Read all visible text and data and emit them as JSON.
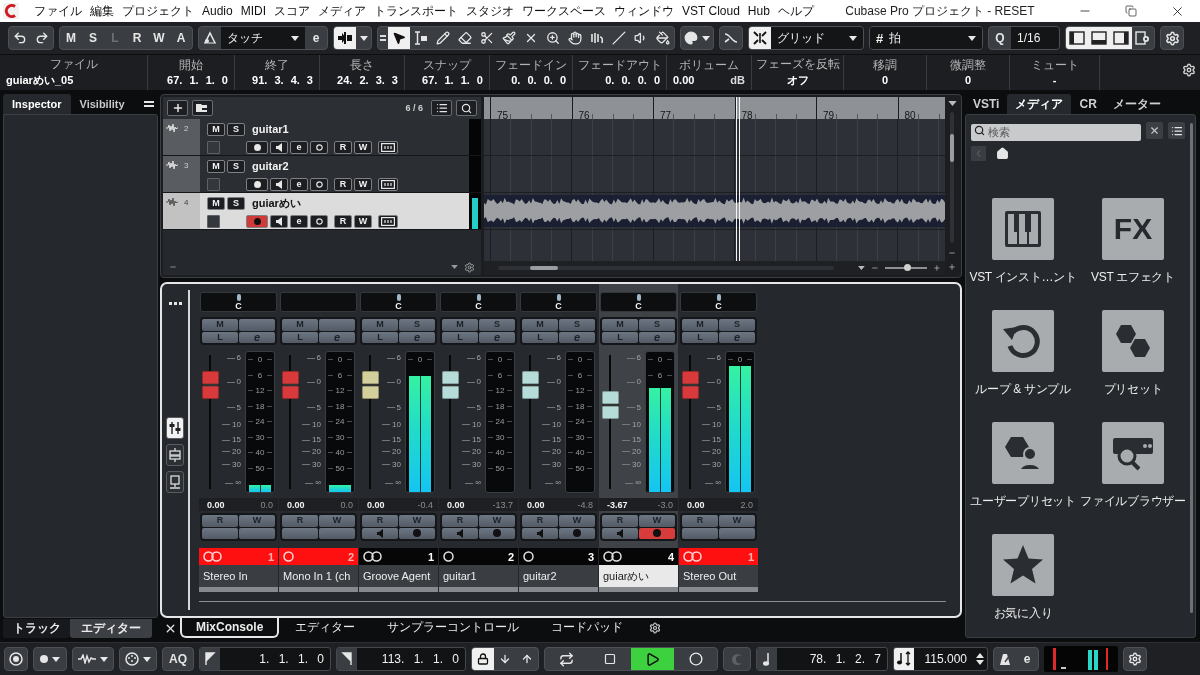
{
  "title_bar": {
    "menu": [
      "ファイル",
      "編集",
      "プロジェクト",
      "Audio",
      "MIDI",
      "スコア",
      "メディア",
      "トランスポート",
      "スタジオ",
      "ワークスペース",
      "ウィンドウ",
      "VST Cloud",
      "Hub",
      "ヘルプ"
    ],
    "title": "Cubase Pro プロジェクト - RESET"
  },
  "toolbar": {
    "state_buttons": [
      {
        "label": "M",
        "disabled": false
      },
      {
        "label": "S",
        "disabled": false
      },
      {
        "label": "L",
        "disabled": true
      },
      {
        "label": "R",
        "disabled": false
      },
      {
        "label": "W",
        "disabled": false
      },
      {
        "label": "A",
        "disabled": false
      }
    ],
    "automation_mode": "タッチ",
    "automation_edit": "e",
    "drag_mode": {
      "on": true
    },
    "tools": [
      {
        "kind": "select",
        "selected": true
      },
      {
        "kind": "range",
        "selected": false
      },
      {
        "kind": "draw",
        "selected": false
      },
      {
        "kind": "erase",
        "selected": false
      },
      {
        "kind": "split",
        "selected": false
      },
      {
        "kind": "glue",
        "selected": false
      },
      {
        "kind": "mute",
        "selected": false
      },
      {
        "kind": "zoom",
        "selected": false
      },
      {
        "kind": "hand",
        "selected": false
      },
      {
        "kind": "comp",
        "selected": false
      },
      {
        "kind": "line",
        "selected": false
      },
      {
        "kind": "play",
        "selected": false
      },
      {
        "kind": "fill",
        "selected": false
      }
    ],
    "snap": {
      "on": true,
      "mode": "グリッド"
    },
    "grid_type": {
      "symbol": "#",
      "value": "拍"
    },
    "quantize": {
      "symbol": "Q",
      "value": "1/16"
    },
    "zone_toggles": [
      {
        "kind": "left",
        "on": true
      },
      {
        "kind": "lower",
        "on": true
      },
      {
        "kind": "right",
        "on": true
      },
      {
        "kind": "setup",
        "on": false
      }
    ]
  },
  "info_line": {
    "file_label": "ファイル",
    "file": "guiarめい_05",
    "fields": [
      {
        "kind": "position",
        "label": "開始",
        "value": "67. 1. 1. 0"
      },
      {
        "kind": "position",
        "label": "終了",
        "value": "91. 3. 4. 3"
      },
      {
        "kind": "position",
        "label": "長さ",
        "value": "24. 2. 3. 3"
      },
      {
        "kind": "position",
        "label": "スナップ",
        "value": "67. 1. 1. 0"
      },
      {
        "kind": "position",
        "label": "フェードイン",
        "value": "0. 0. 0. 0"
      },
      {
        "kind": "position",
        "label": "フェードアウト",
        "value": "0. 0. 0. 0"
      },
      {
        "kind": "volume",
        "label": "ボリューム",
        "value": "0.00",
        "unit": "dB"
      },
      {
        "kind": "text",
        "label": "フェーズを反転",
        "value": "オフ"
      },
      {
        "kind": "text",
        "label": "移調",
        "value": "0"
      },
      {
        "kind": "text",
        "label": "微調整",
        "value": "0"
      },
      {
        "kind": "text",
        "label": "ミュート",
        "value": "-"
      }
    ]
  },
  "left_zone": {
    "tabs": [
      {
        "label": "Inspector",
        "selected": true
      },
      {
        "label": "Visibility",
        "selected": false
      }
    ],
    "bottom_tabs": [
      {
        "label": "トラック",
        "selected": true
      },
      {
        "label": "エディター",
        "selected": false
      }
    ]
  },
  "project": {
    "track_count": "6 / 6",
    "tracks": [
      {
        "number": "2",
        "name": "guitar1",
        "mute": "M",
        "solo": "S",
        "edit": "e",
        "read": "R",
        "write": "W",
        "selected": false,
        "record_enabled": false,
        "has_audio_event": false,
        "meter": {
          "level": 0
        }
      },
      {
        "number": "3",
        "name": "guitar2",
        "mute": "M",
        "solo": "S",
        "edit": "e",
        "read": "R",
        "write": "W",
        "selected": false,
        "record_enabled": false,
        "has_audio_event": false,
        "meter": {
          "level": 0
        }
      },
      {
        "number": "4",
        "name": "guiarめい",
        "mute": "M",
        "solo": "S",
        "edit": "e",
        "read": "R",
        "write": "W",
        "selected": true,
        "record_enabled": true,
        "has_audio_event": true,
        "meter": {
          "level": 0.85
        }
      }
    ],
    "ruler": [
      "75",
      "76",
      "77",
      "78",
      "79",
      "80"
    ],
    "zoom": {
      "level": 0.55
    }
  },
  "lower_zone": {
    "view_buttons": [
      {
        "kind": "faders",
        "selected": true
      },
      {
        "kind": "racks",
        "selected": false
      },
      {
        "kind": "monitor",
        "selected": false
      }
    ],
    "channels": [
      {
        "kind": "input",
        "stereo": true,
        "pan": "C",
        "mute": "M",
        "listen": "L",
        "edit": "e",
        "read": "R",
        "write": "W",
        "fader_scale": [
          "6",
          "0",
          "5",
          "10",
          "15",
          "20",
          "30",
          "∞"
        ],
        "fader": {
          "level": 0.85
        },
        "meter_scale": [
          "0",
          "6",
          "12",
          "18",
          "24",
          "30",
          "40",
          "50"
        ],
        "meter": {
          "level": 0.05
        },
        "volume": "0.00",
        "peak": "0.0",
        "number": "1",
        "name": "Stereo In",
        "selected": false
      },
      {
        "kind": "input",
        "stereo": false,
        "mute": "M",
        "listen": "L",
        "edit": "e",
        "read": "R",
        "write": "W",
        "fader_scale": [
          "6",
          "0",
          "5",
          "10",
          "15",
          "20",
          "30",
          "∞"
        ],
        "fader": {
          "level": 0.85
        },
        "meter_scale": [
          "0",
          "6",
          "12",
          "18",
          "24",
          "30",
          "40",
          "50"
        ],
        "meter": {
          "level": 0.05
        },
        "volume": "0.00",
        "peak": "0.0",
        "number": "2",
        "name": "Mono In 1 (ch",
        "selected": false
      },
      {
        "kind": "instrument",
        "stereo": true,
        "pan": "C",
        "mute": "M",
        "solo": "S",
        "listen": "L",
        "edit": "e",
        "read": "R",
        "write": "W",
        "fader_scale": [
          "6",
          "0",
          "5",
          "10",
          "15",
          "20",
          "30",
          "∞"
        ],
        "fader": {
          "level": 0.85
        },
        "meter_scale": [
          "0"
        ],
        "meter": {
          "level": 0.83
        },
        "volume": "0.00",
        "peak": "-0.4",
        "number": "1",
        "name": "Groove Agent",
        "selected": false,
        "record_enabled": false
      },
      {
        "kind": "audio",
        "stereo": false,
        "pan": "C",
        "mute": "M",
        "solo": "S",
        "listen": "L",
        "edit": "e",
        "read": "R",
        "write": "W",
        "fader_scale": [
          "6",
          "0",
          "5",
          "10",
          "15",
          "20",
          "30",
          "∞"
        ],
        "fader": {
          "level": 0.85
        },
        "meter_scale": [
          "0",
          "6",
          "12",
          "18",
          "24",
          "30",
          "40",
          "50"
        ],
        "meter": {
          "level": 0
        },
        "volume": "0.00",
        "peak": "-13.7",
        "number": "2",
        "name": "guitar1",
        "selected": false,
        "record_enabled": false
      },
      {
        "kind": "audio",
        "stereo": false,
        "pan": "C",
        "mute": "M",
        "solo": "S",
        "listen": "L",
        "edit": "e",
        "read": "R",
        "write": "W",
        "fader_scale": [
          "6",
          "0",
          "5",
          "10",
          "15",
          "20",
          "30",
          "∞"
        ],
        "fader": {
          "level": 0.85
        },
        "meter_scale": [
          "0",
          "6",
          "12",
          "18",
          "24",
          "30",
          "40",
          "50"
        ],
        "meter": {
          "level": 0
        },
        "volume": "0.00",
        "peak": "-4.8",
        "number": "3",
        "name": "guitar2",
        "selected": false,
        "record_enabled": false
      },
      {
        "kind": "audio",
        "stereo": true,
        "pan": "C",
        "mute": "M",
        "solo": "S",
        "listen": "L",
        "edit": "e",
        "read": "R",
        "write": "W",
        "fader_scale": [
          "6",
          "0",
          "5",
          "10",
          "15",
          "20",
          "30",
          "∞"
        ],
        "fader": {
          "level": 0.66
        },
        "meter_scale": [
          "0",
          "6"
        ],
        "meter": {
          "level": 0.74
        },
        "volume": "-3.67",
        "peak": "-3.0",
        "number": "4",
        "name": "guiarめい",
        "selected": true,
        "record_enabled": true
      },
      {
        "kind": "output",
        "stereo": true,
        "pan": "C",
        "mute": "M",
        "solo": "S",
        "listen": "L",
        "edit": "e",
        "read": "R",
        "write": "W",
        "fader_scale": [
          "6",
          "0",
          "5",
          "10",
          "15",
          "20",
          "30",
          "∞"
        ],
        "fader": {
          "level": 0.85
        },
        "meter_scale": [
          "0"
        ],
        "meter": {
          "level": 0.9
        },
        "volume": "0.00",
        "peak": "2.0",
        "number": "1",
        "name": "Stereo Out",
        "selected": false
      }
    ],
    "tabs": [
      {
        "label": "MixConsole",
        "selected": true
      },
      {
        "label": "エディター",
        "selected": false
      },
      {
        "label": "サンプラーコントロール",
        "selected": false
      },
      {
        "label": "コードパッド",
        "selected": false
      }
    ]
  },
  "right_zone": {
    "tabs": [
      {
        "label": "VSTi",
        "selected": false
      },
      {
        "label": "メディア",
        "selected": true
      },
      {
        "label": "CR",
        "selected": false
      },
      {
        "label": "メーター",
        "selected": false
      }
    ],
    "search": {
      "placeholder": "検索"
    },
    "back": {
      "disabled": true
    },
    "tile_rows": [
      {
        "tiles": [
          {
            "kind": "instruments",
            "label": "VST インスト…ント"
          },
          {
            "kind": "effects",
            "glyph": "FX",
            "label": "VST エフェクト"
          }
        ]
      },
      {
        "tiles": [
          {
            "kind": "loops",
            "label": "ループ & サンプル"
          },
          {
            "kind": "presets",
            "label": "プリセット"
          }
        ]
      },
      {
        "tiles": [
          {
            "kind": "user_presets",
            "label": "ユーザープリセット"
          },
          {
            "kind": "file_browser",
            "label": "ファイルブラウザー"
          }
        ]
      },
      {
        "tiles": [
          {
            "kind": "favorites",
            "label": "お気に入り"
          }
        ]
      }
    ]
  },
  "transport": {
    "aq": "AQ",
    "left_locator": "1. 1. 1. 0",
    "right_locator": "113. 1. 1. 0",
    "buttons": [
      {
        "kind": "cycle",
        "on": false
      },
      {
        "kind": "stop",
        "on": false
      },
      {
        "kind": "play",
        "on": true
      },
      {
        "kind": "record",
        "on": false
      }
    ],
    "sync": {
      "disabled": true
    },
    "position": "78. 1. 2. 7",
    "tempo": "115.000",
    "click_edit": "e"
  }
}
